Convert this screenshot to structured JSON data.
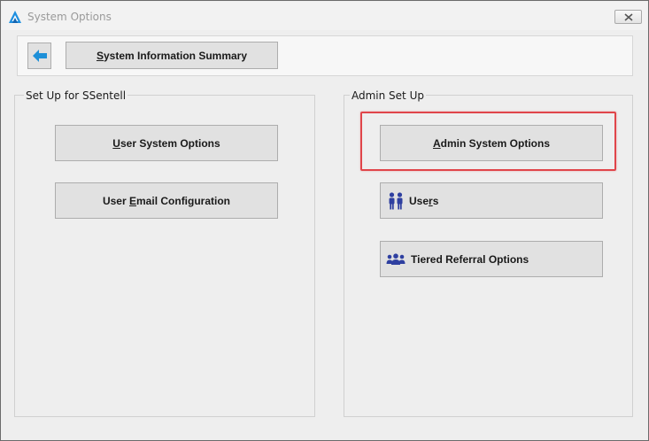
{
  "window": {
    "title": "System Options"
  },
  "toolbar": {
    "summary_button": {
      "mnemonic": "S",
      "rest": "ystem Information Summary"
    }
  },
  "left_group": {
    "label": "Set Up for SSentell",
    "user_system_options": {
      "mnemonic": "U",
      "rest": "ser System Options"
    },
    "user_email_configuration": {
      "before": "User ",
      "mnemonic": "E",
      "rest": "mail Configuration"
    }
  },
  "right_group": {
    "label": "Admin Set Up",
    "admin_system_options": {
      "mnemonic": "A",
      "rest": "dmin System Options"
    },
    "users": {
      "before": "Use",
      "mnemonic": "r",
      "rest": "s"
    },
    "tiered_referral_options": {
      "label": "Tiered Referral Options"
    }
  },
  "colors": {
    "highlight": "#e0454a",
    "back_arrow": "#1e90d8",
    "users_icon": "#2e3fa0",
    "app_icon": "#1e8fe0"
  },
  "icons": {
    "app": "app-logo-icon",
    "close": "close-icon",
    "back": "back-arrow-icon",
    "users": "users-icon",
    "tiered": "group-people-icon"
  }
}
